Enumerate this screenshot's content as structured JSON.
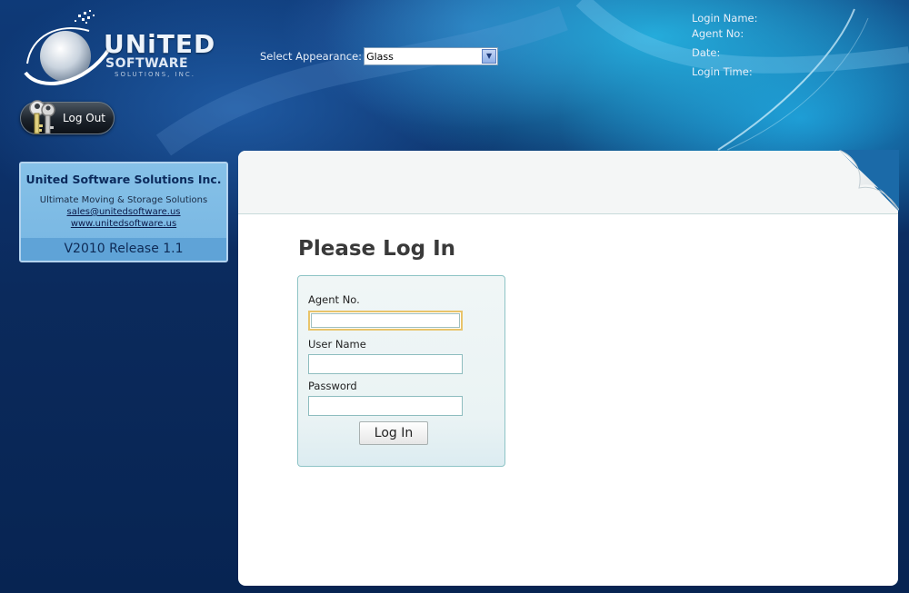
{
  "header": {
    "logo": {
      "line1": "UNiTED",
      "line2": "SOFTWARE",
      "line3": "SOLUTIONS, INC."
    },
    "appearance": {
      "label": "Select Appearance:",
      "selected": "Glass"
    },
    "session": {
      "login_name_label": "Login Name:",
      "agent_no_label": "Agent No:",
      "date_label": "Date:",
      "login_time_label": "Login Time:"
    },
    "logout_label": "Log Out"
  },
  "sidebar": {
    "company": "United Software Solutions Inc.",
    "tagline": "Ultimate Moving & Storage Solutions",
    "email": "sales@unitedsoftware.us",
    "website": "www.unitedsoftware.us",
    "version": "V2010 Release 1.1"
  },
  "login": {
    "title": "Please Log In",
    "agent_no_label": "Agent No.",
    "agent_no_value": "",
    "username_label": "User Name",
    "username_value": "",
    "password_label": "Password",
    "password_value": "",
    "submit_label": "Log In"
  },
  "colors": {
    "background": "#0b2a5c",
    "panel": "#ffffff",
    "info_box": "#7cbae4",
    "login_box_border": "#8ec4c6",
    "focus_border": "#e9c46a"
  }
}
